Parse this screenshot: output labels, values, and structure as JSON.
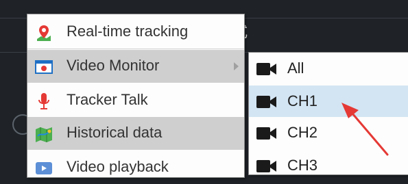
{
  "background": {
    "char": "式"
  },
  "context_menu": {
    "items": [
      {
        "label": "Real-time tracking",
        "icon": "map-pin-icon"
      },
      {
        "label": "Video Monitor",
        "icon": "video-monitor-icon",
        "has_submenu": true
      },
      {
        "label": "Tracker Talk",
        "icon": "microphone-icon"
      },
      {
        "label": "Historical data",
        "icon": "map-history-icon"
      },
      {
        "label": "Video playback",
        "icon": "video-playback-icon"
      }
    ]
  },
  "submenu": {
    "items": [
      {
        "label": "All",
        "icon": "camera-icon"
      },
      {
        "label": "CH1",
        "icon": "camera-icon"
      },
      {
        "label": "CH2",
        "icon": "camera-icon"
      },
      {
        "label": "CH3",
        "icon": "camera-icon"
      }
    ],
    "selected": "CH1"
  },
  "colors": {
    "highlight": "#cfcfcf",
    "selected": "#d3e5f3",
    "annotation_arrow": "#e53935"
  }
}
